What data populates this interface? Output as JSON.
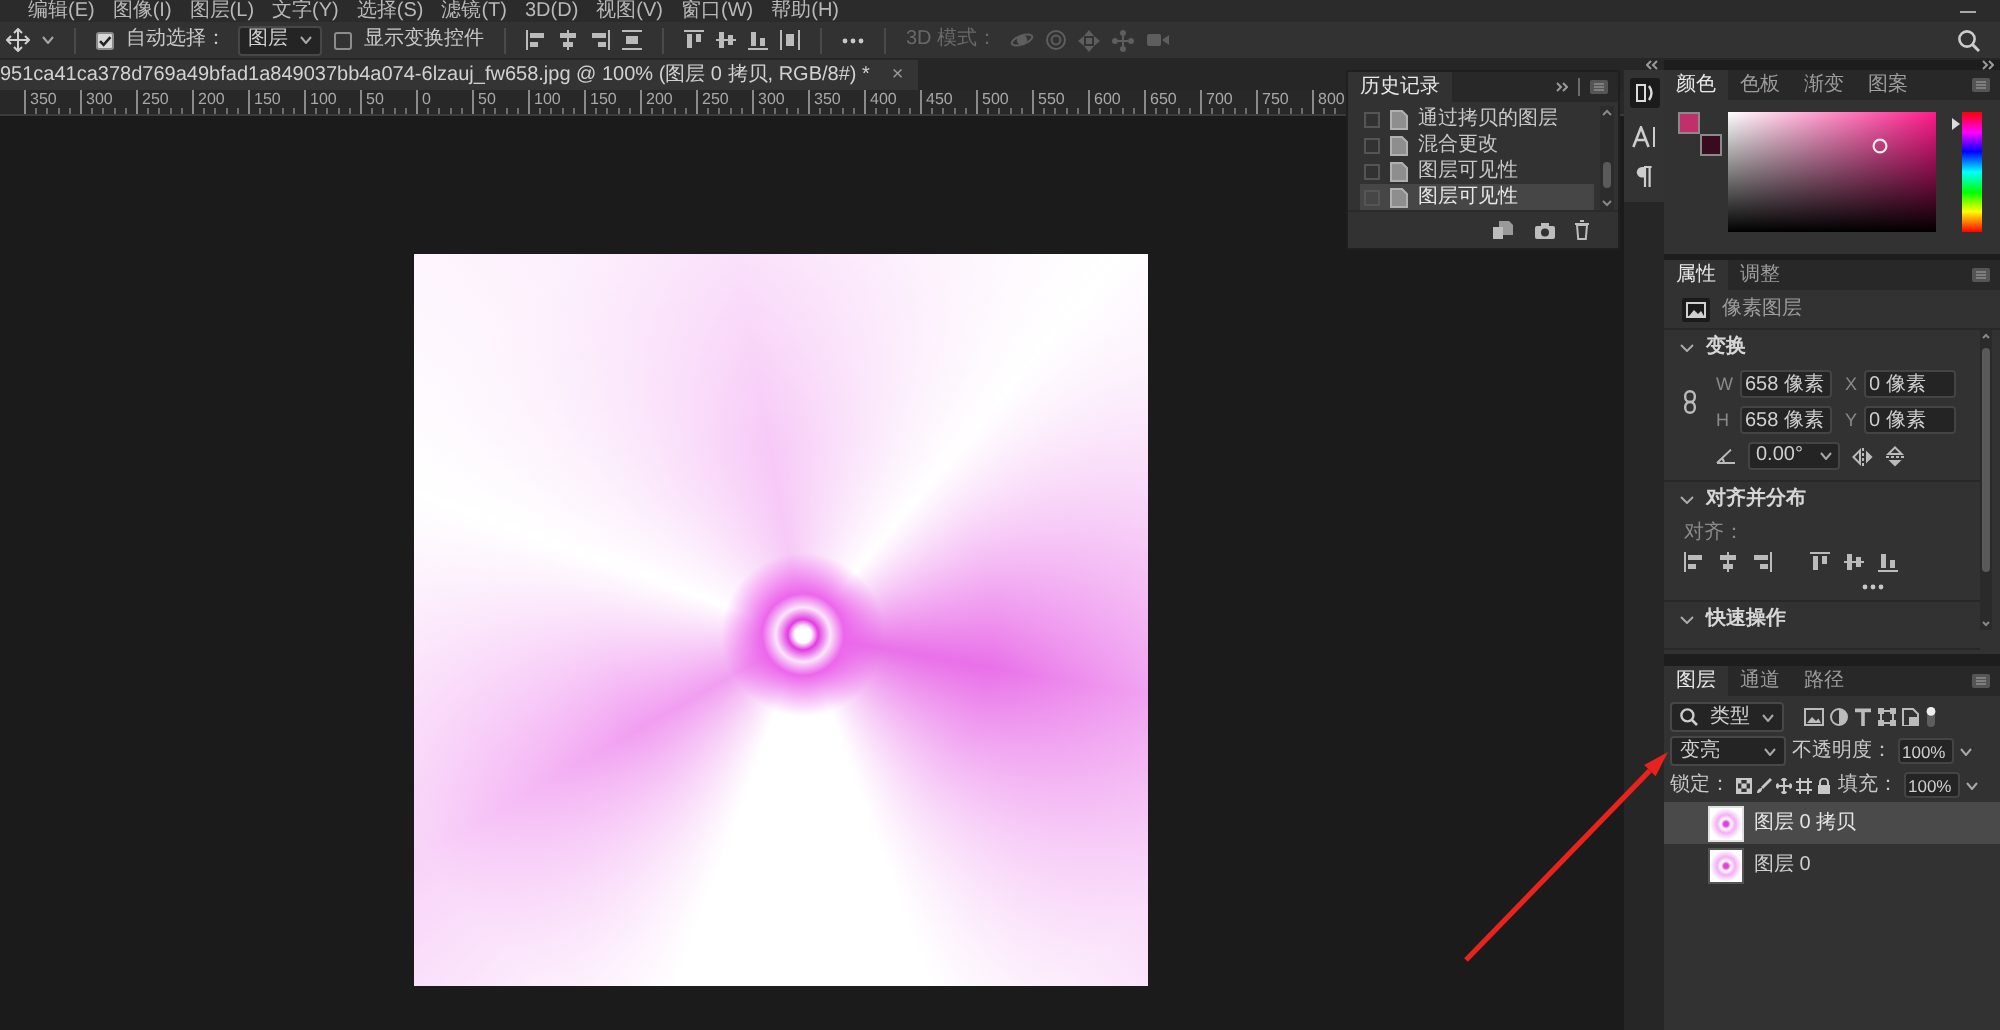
{
  "menu_bar": {
    "items": [
      "编辑(E)",
      "图像(I)",
      "图层(L)",
      "文字(Y)",
      "选择(S)",
      "滤镜(T)",
      "3D(D)",
      "视图(V)",
      "窗口(W)",
      "帮助(H)"
    ]
  },
  "options_bar": {
    "auto_select": {
      "label": "自动选择：",
      "checked": true
    },
    "auto_select_target": "图层",
    "show_transform_controls": {
      "label": "显示变换控件",
      "checked": false
    },
    "mode_3d": {
      "label": "3D 模式：",
      "disabled": true
    }
  },
  "document_tab": {
    "title": "951ca41ca378d769a49bfad1a849037bb4a074-6lzauj_fw658.jpg @ 100% (图层 0 拷贝, RGB/8#) *",
    "close": "×"
  },
  "ruler": {
    "labels": [
      "350",
      "300",
      "250",
      "200",
      "150",
      "100",
      "50",
      "0",
      "50",
      "100",
      "150",
      "200",
      "250",
      "300",
      "350",
      "400",
      "450",
      "500",
      "550",
      "600",
      "650",
      "700",
      "750",
      "800"
    ]
  },
  "history_panel": {
    "tabs": [
      {
        "label": "历史记录",
        "selected": true
      }
    ],
    "items": [
      {
        "label": "通过拷贝的图层",
        "selected": false
      },
      {
        "label": "混合更改",
        "selected": false
      },
      {
        "label": "图层可见性",
        "selected": false
      },
      {
        "label": "图层可见性",
        "selected": true
      }
    ]
  },
  "color_panel": {
    "tabs": [
      {
        "label": "颜色",
        "selected": true
      },
      {
        "label": "色板",
        "selected": false
      },
      {
        "label": "渐变",
        "selected": false
      },
      {
        "label": "图案",
        "selected": false
      }
    ],
    "swatches": [
      {
        "kind": "foreground",
        "color": "#c2306c"
      },
      {
        "kind": "background",
        "color": "#3a0a1e"
      }
    ],
    "hue_slider": {
      "level": 0.95
    }
  },
  "properties_panel": {
    "tabs": [
      {
        "label": "属性",
        "selected": true
      },
      {
        "label": "调整",
        "selected": false
      }
    ],
    "layer_kind": "像素图层",
    "sections": [
      {
        "title": "变换",
        "expanded": true
      },
      {
        "title": "对齐并分布",
        "expanded": true
      },
      {
        "title": "快速操作",
        "expanded": true
      }
    ],
    "transform_fields": [
      {
        "label": "W",
        "value": "658 像素"
      },
      {
        "label": "X",
        "value": "0 像素"
      },
      {
        "label": "H",
        "value": "658 像素"
      },
      {
        "label": "Y",
        "value": "0 像素"
      }
    ],
    "angle": "0.00°",
    "align_label": "对齐："
  },
  "layers_panel": {
    "tabs": [
      {
        "label": "图层",
        "selected": true
      },
      {
        "label": "通道",
        "selected": false
      },
      {
        "label": "路径",
        "selected": false
      }
    ],
    "filter_kind": "类型",
    "blend_mode": "变亮",
    "opacity_label": "不透明度：",
    "opacity": "100%",
    "lock_label": "锁定：",
    "fill_label": "填充：",
    "fill": "100%",
    "layers": [
      {
        "name": "图层 0 拷贝",
        "selected": true
      },
      {
        "name": "图层 0",
        "selected": false
      }
    ]
  }
}
